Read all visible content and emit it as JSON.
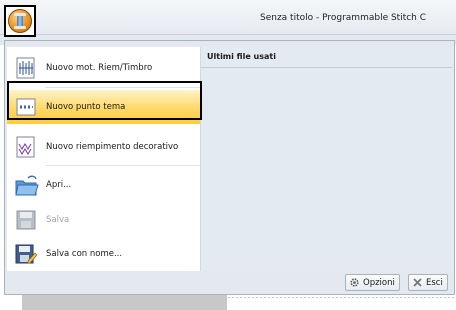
{
  "window": {
    "title": "Senza titolo - Programmable Stitch C",
    "app_button_icon": "bobbin-icon"
  },
  "menu": {
    "items": [
      {
        "label": "Nuovo mot. Riem/Timbro",
        "icon": "fill-stamp-icon",
        "state": "normal"
      },
      {
        "label": "Nuovo punto tema",
        "icon": "motif-stitch-icon",
        "state": "selected"
      },
      {
        "label": "Nuovo riempimento decorativo",
        "icon": "decorative-fill-icon",
        "state": "normal"
      },
      {
        "label": "Apri...",
        "icon": "open-folder-icon",
        "state": "normal"
      },
      {
        "label": "Salva",
        "icon": "save-disk-icon",
        "state": "disabled"
      },
      {
        "label": "Salva con nome...",
        "icon": "save-as-icon",
        "state": "normal"
      }
    ],
    "recent_header": "Ultimi file usati",
    "options_label": "Opzioni",
    "exit_label": "Esci"
  },
  "colors": {
    "selected_gradient": [
      "#fff3c9",
      "#ffcc3c"
    ],
    "menu_background": "#e4e9ef",
    "app_button": "#e08a1a"
  }
}
